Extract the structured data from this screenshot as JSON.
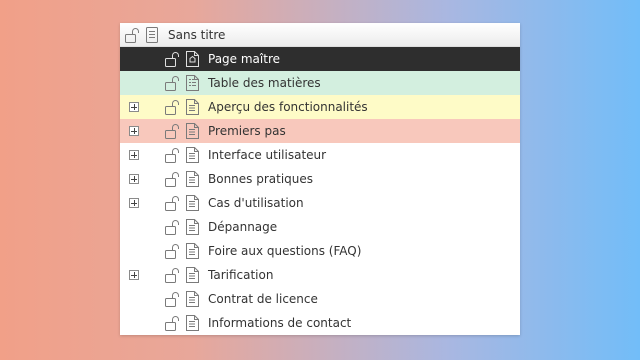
{
  "tree": {
    "root": {
      "label": "Sans titre"
    },
    "items": [
      {
        "label": "Page maître",
        "state": "selected",
        "expandable": false,
        "doc_icon": "master-page-icon"
      },
      {
        "label": "Table des matières",
        "state": "green",
        "expandable": false,
        "doc_icon": "toc-document-icon"
      },
      {
        "label": "Aperçu des fonctionnalités",
        "state": "yellow",
        "expandable": true,
        "doc_icon": "document-icon"
      },
      {
        "label": "Premiers pas",
        "state": "red",
        "expandable": true,
        "doc_icon": "document-icon"
      },
      {
        "label": "Interface utilisateur",
        "state": "normal",
        "expandable": true,
        "doc_icon": "document-icon"
      },
      {
        "label": "Bonnes pratiques",
        "state": "normal",
        "expandable": true,
        "doc_icon": "document-icon"
      },
      {
        "label": "Cas d'utilisation",
        "state": "normal",
        "expandable": true,
        "doc_icon": "document-icon"
      },
      {
        "label": "Dépannage",
        "state": "normal",
        "expandable": false,
        "doc_icon": "document-icon"
      },
      {
        "label": "Foire aux questions (FAQ)",
        "state": "normal",
        "expandable": false,
        "doc_icon": "document-icon"
      },
      {
        "label": "Tarification",
        "state": "normal",
        "expandable": true,
        "doc_icon": "document-icon"
      },
      {
        "label": "Contrat de licence",
        "state": "normal",
        "expandable": false,
        "doc_icon": "document-icon"
      },
      {
        "label": "Informations de contact",
        "state": "normal",
        "expandable": false,
        "doc_icon": "document-icon"
      }
    ]
  },
  "colors": {
    "selected": "#2e2e2e",
    "green": "#d3efdf",
    "yellow": "#fefbc7",
    "red": "#f8c8bc",
    "icon_stroke": "#7a7a7a",
    "icon_stroke_selected": "#e0e0e0"
  }
}
